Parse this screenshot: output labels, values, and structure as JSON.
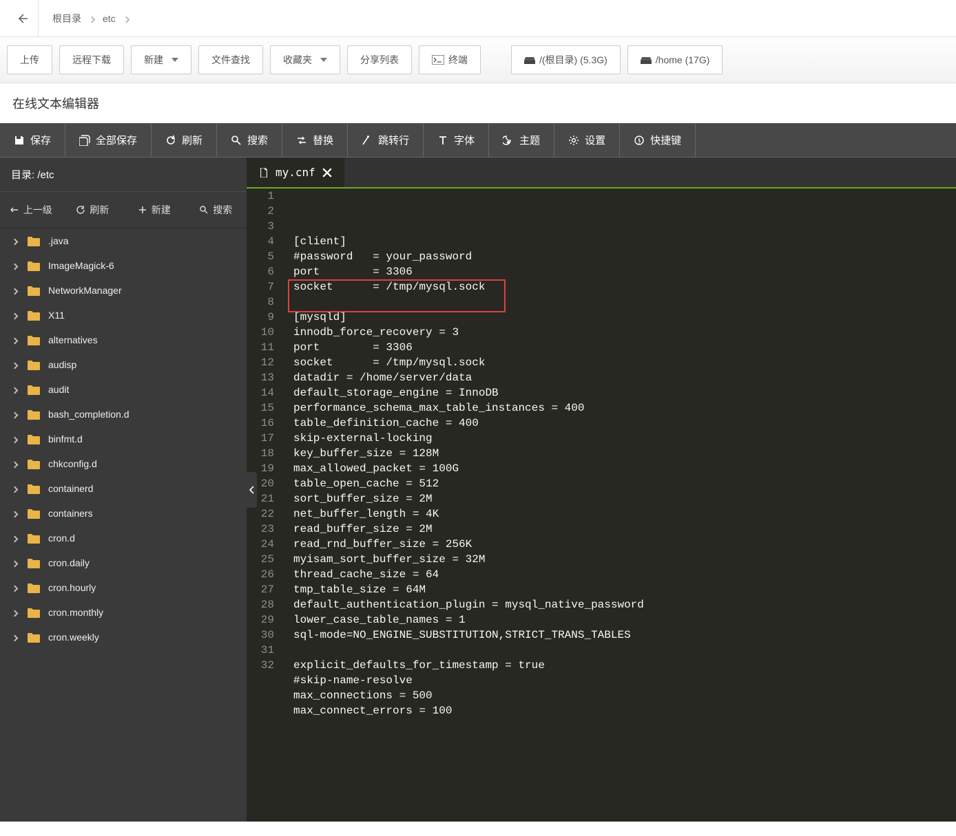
{
  "breadcrumb": {
    "items": [
      "根目录",
      "etc"
    ]
  },
  "toolbar": {
    "upload": "上传",
    "remote_download": "远程下载",
    "new": "新建",
    "file_search": "文件查找",
    "favorites": "收藏夹",
    "share_list": "分享列表",
    "terminal": "终端",
    "root_disk": "/(根目录) (5.3G)",
    "home_disk": "/home (17G)"
  },
  "panel_title": "在线文本编辑器",
  "editor_toolbar": {
    "save": "保存",
    "save_all": "全部保存",
    "refresh": "刷新",
    "search": "搜索",
    "replace": "替换",
    "goto": "跳转行",
    "font": "字体",
    "theme": "主题",
    "settings": "设置",
    "shortcuts": "快捷键"
  },
  "sidebar": {
    "dir_label": "目录:",
    "dir_path": "/etc",
    "actions": {
      "up": "上一级",
      "refresh": "刷新",
      "new": "新建",
      "search": "搜索"
    },
    "folders": [
      ".java",
      "ImageMagick-6",
      "NetworkManager",
      "X11",
      "alternatives",
      "audisp",
      "audit",
      "bash_completion.d",
      "binfmt.d",
      "chkconfig.d",
      "containerd",
      "containers",
      "cron.d",
      "cron.daily",
      "cron.hourly",
      "cron.monthly",
      "cron.weekly"
    ]
  },
  "tab": {
    "filename": "my.cnf"
  },
  "code": {
    "lines": [
      "[client]",
      "#password   = your_password",
      "port        = 3306",
      "socket      = /tmp/mysql.sock",
      "",
      "[mysqld]",
      "innodb_force_recovery = 3",
      "port        = 3306",
      "socket      = /tmp/mysql.sock",
      "datadir = /home/server/data",
      "default_storage_engine = InnoDB",
      "performance_schema_max_table_instances = 400",
      "table_definition_cache = 400",
      "skip-external-locking",
      "key_buffer_size = 128M",
      "max_allowed_packet = 100G",
      "table_open_cache = 512",
      "sort_buffer_size = 2M",
      "net_buffer_length = 4K",
      "read_buffer_size = 2M",
      "read_rnd_buffer_size = 256K",
      "myisam_sort_buffer_size = 32M",
      "thread_cache_size = 64",
      "tmp_table_size = 64M",
      "default_authentication_plugin = mysql_native_password",
      "lower_case_table_names = 1",
      "sql-mode=NO_ENGINE_SUBSTITUTION,STRICT_TRANS_TABLES",
      "",
      "explicit_defaults_for_timestamp = true",
      "#skip-name-resolve",
      "max_connections = 500",
      "max_connect_errors = 100"
    ]
  }
}
